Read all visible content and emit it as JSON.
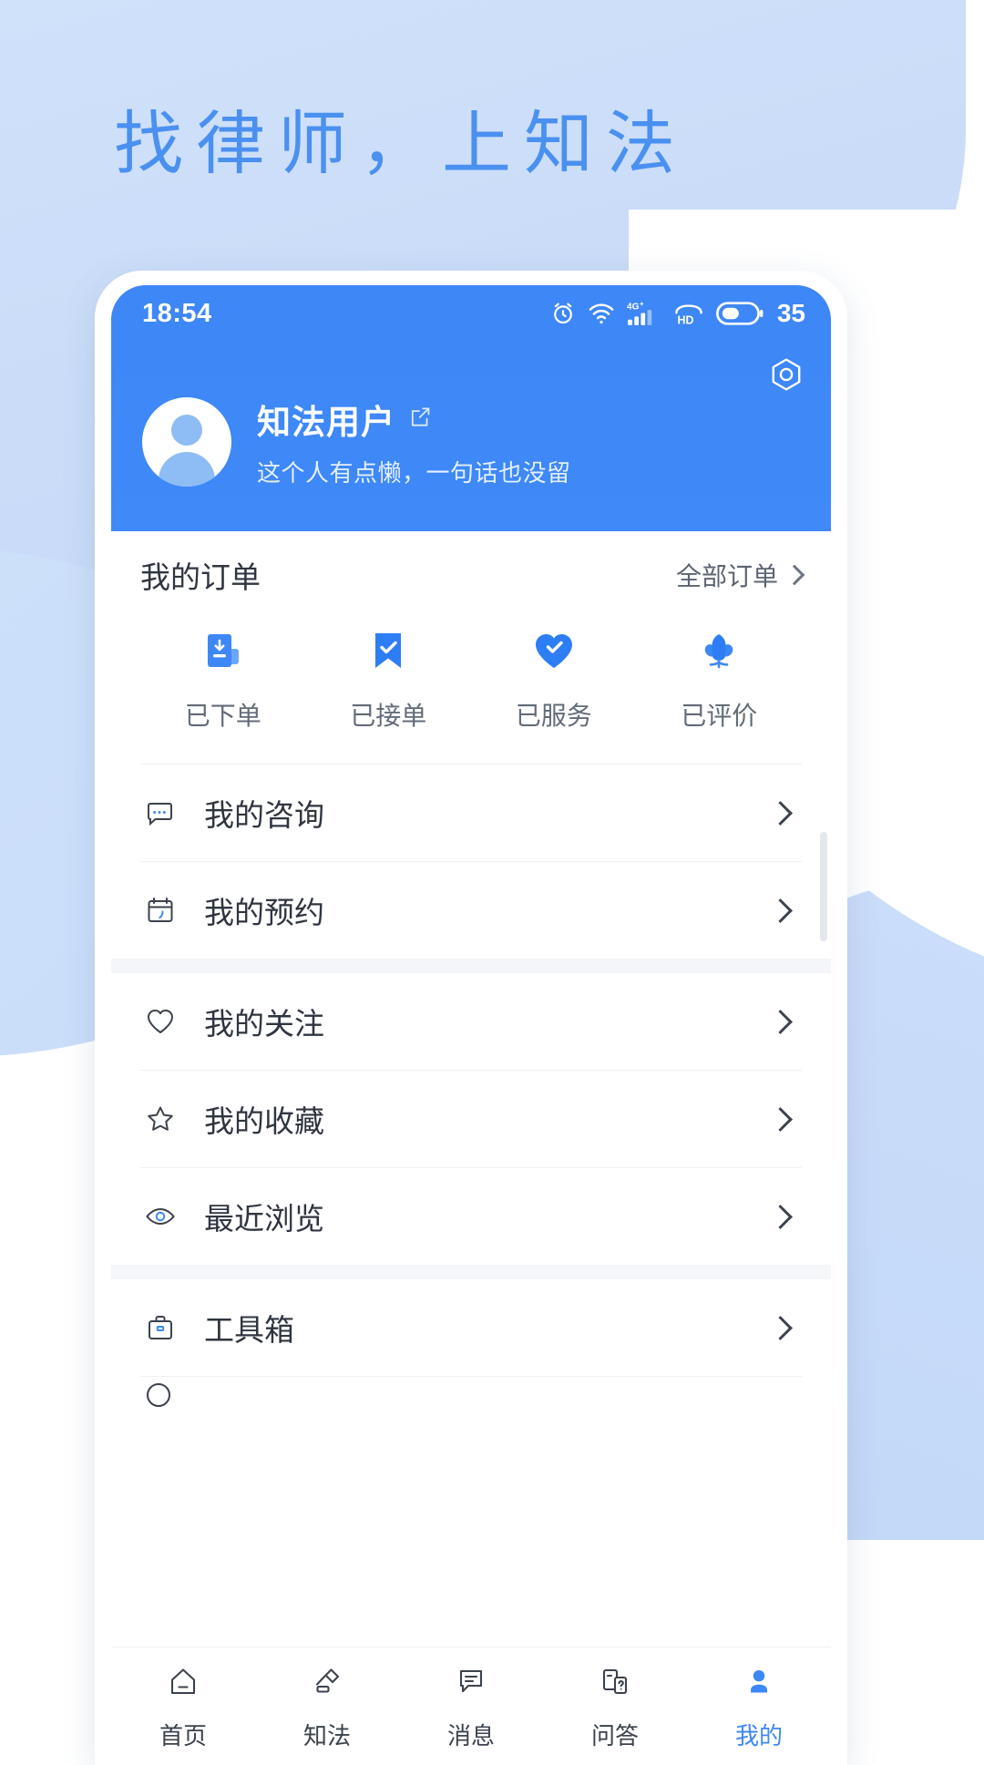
{
  "promo": {
    "headline": "找律师，上知法"
  },
  "status_bar": {
    "time": "18:54",
    "battery_level": "35",
    "icons": [
      "alarm-icon",
      "wifi-icon",
      "signal-4g-icon",
      "hd-call-icon",
      "battery-icon"
    ]
  },
  "profile": {
    "name": "知法用户",
    "bio": "这个人有点懒，一句话也没留",
    "edit_icon": "edit-icon",
    "settings_icon": "hexagon-settings-icon",
    "avatar_icon": "avatar-placeholder-icon"
  },
  "orders": {
    "title": "我的订单",
    "all_orders_label": "全部订单",
    "statuses": [
      {
        "label": "已下单",
        "icon": "order-placed-icon"
      },
      {
        "label": "已接单",
        "icon": "order-accepted-icon"
      },
      {
        "label": "已服务",
        "icon": "order-served-icon"
      },
      {
        "label": "已评价",
        "icon": "order-reviewed-icon"
      }
    ]
  },
  "menu_groups": [
    {
      "items": [
        {
          "label": "我的咨询",
          "icon": "chat-bubble-icon"
        },
        {
          "label": "我的预约",
          "icon": "calendar-icon"
        }
      ]
    },
    {
      "items": [
        {
          "label": "我的关注",
          "icon": "heart-outline-icon"
        },
        {
          "label": "我的收藏",
          "icon": "star-outline-icon"
        },
        {
          "label": "最近浏览",
          "icon": "eye-icon"
        }
      ]
    },
    {
      "items": [
        {
          "label": "工具箱",
          "icon": "briefcase-icon"
        }
      ]
    }
  ],
  "bottom_nav": [
    {
      "label": "首页",
      "icon": "home-icon",
      "active": false
    },
    {
      "label": "知法",
      "icon": "gavel-icon",
      "active": false
    },
    {
      "label": "消息",
      "icon": "message-icon",
      "active": false
    },
    {
      "label": "问答",
      "icon": "qa-icon",
      "active": false
    },
    {
      "label": "我的",
      "icon": "profile-icon",
      "active": true
    }
  ],
  "colors": {
    "brand_blue": "#3d87f7",
    "headline_blue": "#4a90f0",
    "bg_light_blue": "#cfe1fa",
    "text_primary": "#2f3540",
    "text_secondary": "#626b78"
  }
}
